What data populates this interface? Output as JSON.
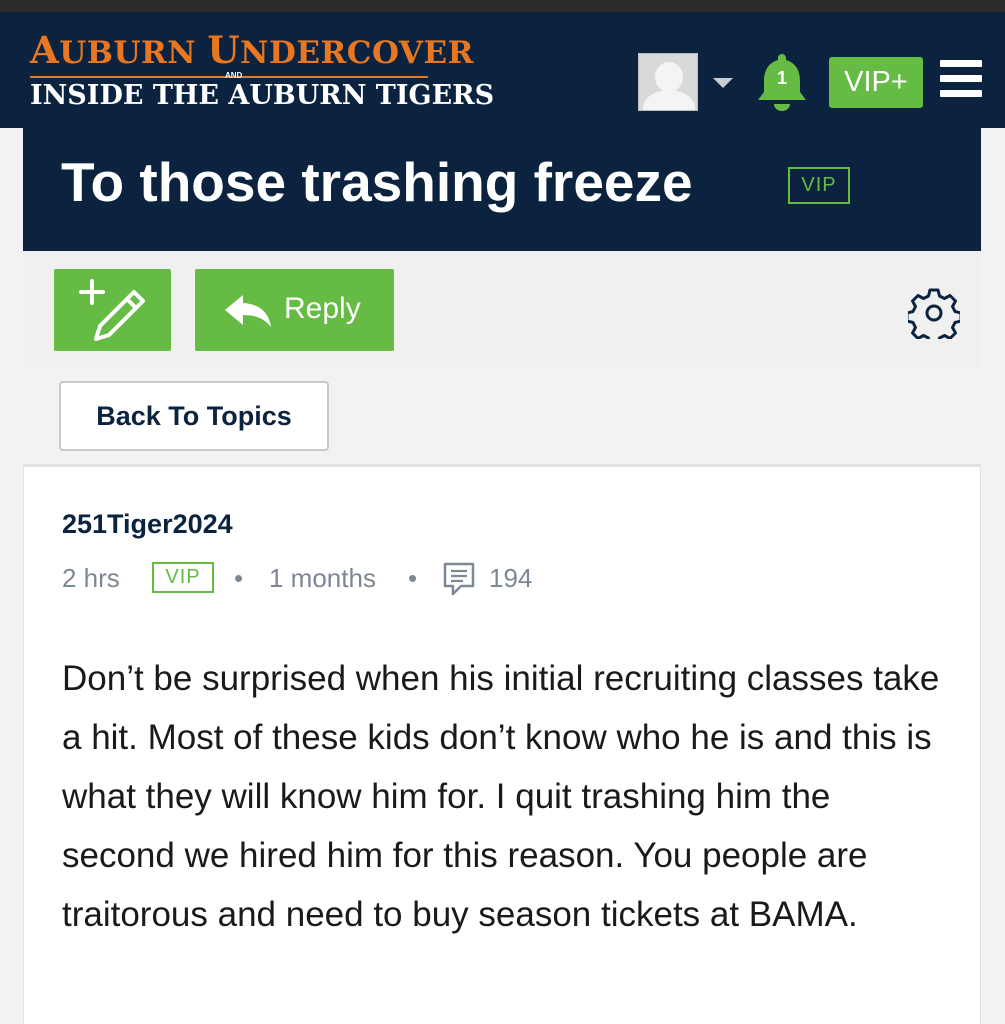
{
  "header": {
    "logo_line1_first": "A",
    "logo_line1_rest1": "UBURN ",
    "logo_line1_second": "U",
    "logo_line1_rest2": "NDERCOVER",
    "logo_and": "AND",
    "logo_line2": "INSIDE THE AUBURN TIGERS",
    "notification_count": "1",
    "vip_plus_label": "VIP+"
  },
  "thread": {
    "title": "To those trashing freeze",
    "badge": "VIP"
  },
  "toolbar": {
    "reply_label": "Reply"
  },
  "nav": {
    "back_label": "Back To Topics"
  },
  "post": {
    "author": "251Tiger2024",
    "time": "2 hrs",
    "badge": "VIP",
    "separator": "•",
    "member_age": "1 months",
    "post_count": "194",
    "body": "Don’t be surprised when his initial recruiting classes take a hit. Most of these kids don’t know who he is and this is what they will know him for. I quit trashing him the second we hired him for this reason. You people are traitorous and need to buy season tickets at BAMA."
  },
  "colors": {
    "navy": "#0c2340",
    "orange": "#e87722",
    "green": "#66bb45",
    "meta_gray": "#7e8794"
  },
  "icons": [
    "user-avatar-icon",
    "chevron-down-icon",
    "bell-icon",
    "menu-icon",
    "new-post-icon",
    "reply-arrow-icon",
    "gear-icon",
    "comment-icon"
  ]
}
